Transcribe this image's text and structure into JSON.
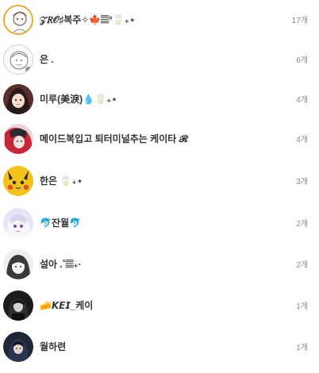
{
  "members": [
    {
      "name": "𝒵𝑅𝒪♯복주✧🍁𝄚°🥛₊⋆",
      "count": "17개"
    },
    {
      "name": "은 .",
      "count": "6개"
    },
    {
      "name": "미루(美淚)💧🥛₊⋆",
      "count": "4개"
    },
    {
      "name": "메이드복입고 퇴터미널추는 케이타 𝓡",
      "count": "4개"
    },
    {
      "name": "한은 🥛₊⋆",
      "count": "3개"
    },
    {
      "name": "🐬잔월🐬",
      "count": "2개"
    },
    {
      "name": "설아 .˚𝄚₊·",
      "count": "2개"
    },
    {
      "name": "🧀𝙆𝙀𝙄_케이",
      "count": "1개"
    },
    {
      "name": "월하련",
      "count": "1개"
    }
  ]
}
